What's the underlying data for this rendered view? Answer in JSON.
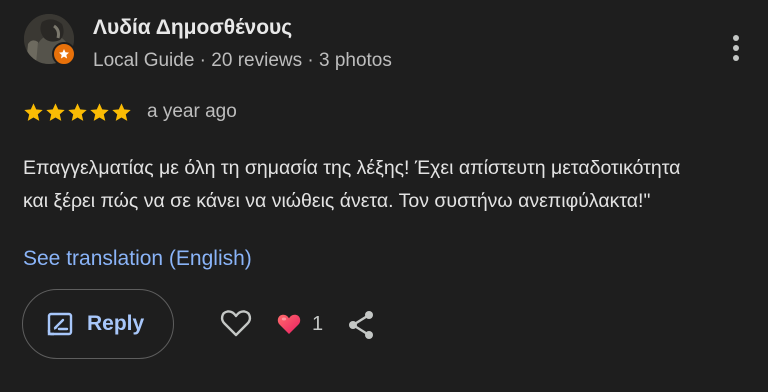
{
  "review": {
    "author": {
      "name": "Λυδία Δημοσθένους",
      "meta": "Local Guide · 20 reviews · 3 photos"
    },
    "rating": 5,
    "time": "a year ago",
    "text": [
      "Επαγγελματίας με όλη τη σημασία της λέξης! Έχει απίστευτη μεταδοτικότητα",
      "και ξέρει πώς να σε κάνει να νιώθεις άνετα. Τον συστήνω ανεπιφύλακτα!\""
    ],
    "translate_link": "See translation (English)"
  },
  "actions": {
    "reply_label": "Reply",
    "reaction_count": "1"
  },
  "icons": {
    "more": "more-vertical-icon",
    "star": "star-icon",
    "reply": "reply-edit-icon",
    "like": "heart-outline-icon",
    "reaction": "heart-filled-icon",
    "share": "share-icon",
    "badge": "local-guide-star-icon"
  },
  "colors": {
    "background": "#1e1e1e",
    "star": "#fbbc04",
    "link": "#8ab4f8",
    "reply_text": "#a8c7fa",
    "badge": "#e8710a",
    "heart_gradient": [
      "#ff6b6b",
      "#e91e63"
    ]
  }
}
